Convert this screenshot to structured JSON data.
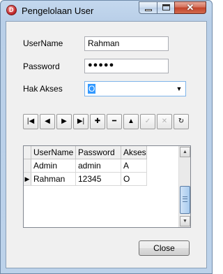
{
  "window": {
    "title": "Pengelolaan User",
    "icon": "delphi-app-icon"
  },
  "form": {
    "username_label": "UserName",
    "username_value": "Rahman",
    "password_label": "Password",
    "password_value": "●●●●●",
    "hak_akses_label": "Hak Akses",
    "hak_akses_value": "O"
  },
  "navigator": [
    {
      "name": "first-record-icon",
      "glyph": "|◀",
      "enabled": true
    },
    {
      "name": "prior-record-icon",
      "glyph": "◀",
      "enabled": true
    },
    {
      "name": "next-record-icon",
      "glyph": "▶",
      "enabled": true
    },
    {
      "name": "last-record-icon",
      "glyph": "▶|",
      "enabled": true
    },
    {
      "name": "insert-record-icon",
      "glyph": "✚",
      "enabled": true
    },
    {
      "name": "delete-record-icon",
      "glyph": "━",
      "enabled": true
    },
    {
      "name": "edit-record-icon",
      "glyph": "▲",
      "enabled": true
    },
    {
      "name": "post-record-icon",
      "glyph": "✓",
      "enabled": false
    },
    {
      "name": "cancel-record-icon",
      "glyph": "✕",
      "enabled": false
    },
    {
      "name": "refresh-record-icon",
      "glyph": "↻",
      "enabled": true
    }
  ],
  "grid": {
    "columns": [
      "UserName",
      "Password",
      "Akses"
    ],
    "rows": [
      [
        "Admin",
        "admin",
        "A"
      ],
      [
        "Rahman",
        "12345",
        "O"
      ]
    ],
    "current_row_marker": "▶"
  },
  "buttons": {
    "close": "Close"
  }
}
